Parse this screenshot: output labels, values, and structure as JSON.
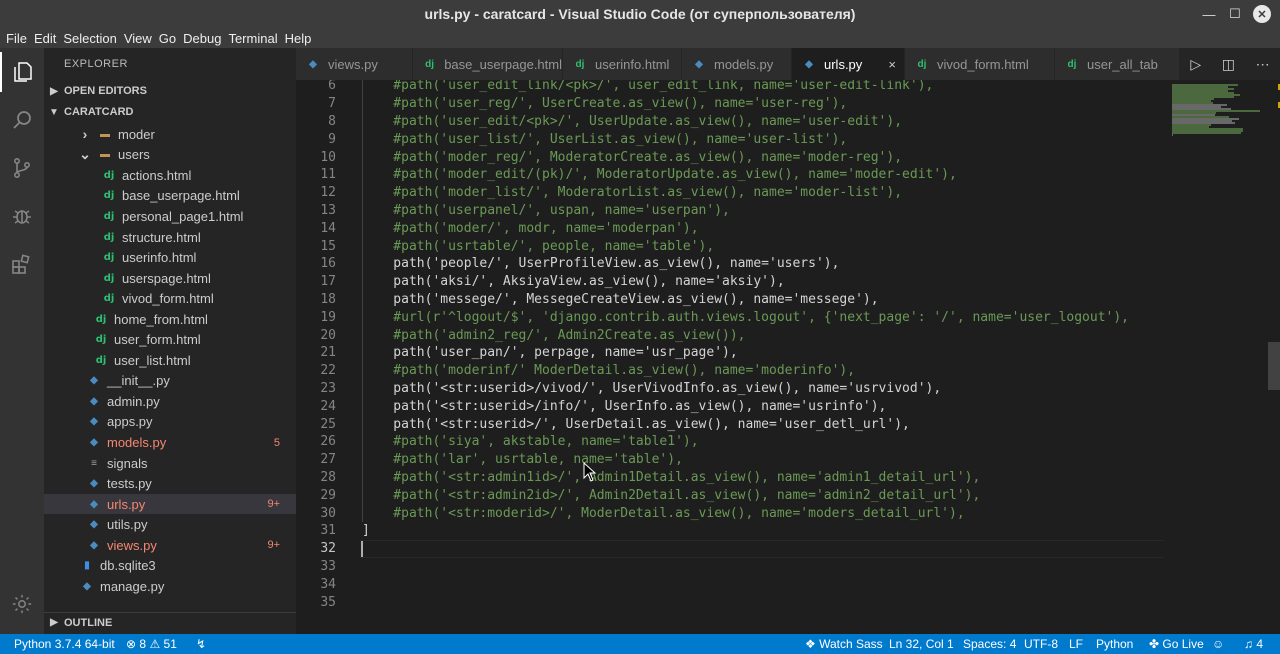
{
  "window": {
    "title": "urls.py - caratcard - Visual Studio Code (от суперпользователя)",
    "min_glyph": "—",
    "max_glyph": "☐",
    "close_glyph": "✕"
  },
  "menu": {
    "items": [
      "File",
      "Edit",
      "Selection",
      "View",
      "Go",
      "Debug",
      "Terminal",
      "Help"
    ]
  },
  "sidebar": {
    "title": "EXPLORER",
    "open_editors_label": "OPEN EDITORS",
    "project_label": "CARATCARD",
    "outline_label": "OUTLINE",
    "tree": [
      {
        "label": "moder",
        "type": "folder",
        "indent": 1,
        "expanded": false
      },
      {
        "label": "users",
        "type": "folder",
        "indent": 1,
        "expanded": true
      },
      {
        "label": "actions.html",
        "type": "dj",
        "indent": 2
      },
      {
        "label": "base_userpage.html",
        "type": "dj",
        "indent": 2
      },
      {
        "label": "personal_page1.html",
        "type": "dj",
        "indent": 2
      },
      {
        "label": "structure.html",
        "type": "dj",
        "indent": 2
      },
      {
        "label": "userinfo.html",
        "type": "dj",
        "indent": 2
      },
      {
        "label": "userspage.html",
        "type": "dj",
        "indent": 2
      },
      {
        "label": "vivod_form.html",
        "type": "dj",
        "indent": 2
      },
      {
        "label": "home_from.html",
        "type": "dj",
        "indent": 1
      },
      {
        "label": "user_form.html",
        "type": "dj",
        "indent": 1
      },
      {
        "label": "user_list.html",
        "type": "dj",
        "indent": 1
      },
      {
        "label": "__init__.py",
        "type": "py",
        "indent": 0
      },
      {
        "label": "admin.py",
        "type": "py",
        "indent": 0
      },
      {
        "label": "apps.py",
        "type": "py",
        "indent": 0
      },
      {
        "label": "models.py",
        "type": "py",
        "indent": 0,
        "badge": "5",
        "error": true
      },
      {
        "label": "signals",
        "type": "file",
        "indent": 0
      },
      {
        "label": "tests.py",
        "type": "py",
        "indent": 0
      },
      {
        "label": "urls.py",
        "type": "py",
        "indent": 0,
        "badge": "9+",
        "error": true,
        "selected": true
      },
      {
        "label": "utils.py",
        "type": "py",
        "indent": 0
      },
      {
        "label": "views.py",
        "type": "py",
        "indent": 0,
        "badge": "9+",
        "error": true
      },
      {
        "label": "db.sqlite3",
        "type": "db",
        "indent": -1
      },
      {
        "label": "manage.py",
        "type": "py",
        "indent": -1
      }
    ]
  },
  "tabs": [
    {
      "label": "views.py",
      "type": "py"
    },
    {
      "label": "base_userpage.html",
      "type": "dj"
    },
    {
      "label": "userinfo.html",
      "type": "dj"
    },
    {
      "label": "models.py",
      "type": "py"
    },
    {
      "label": "urls.py",
      "type": "py",
      "active": true
    },
    {
      "label": "vivod_form.html",
      "type": "dj"
    },
    {
      "label": "user_all_tab",
      "type": "dj"
    }
  ],
  "editor": {
    "current_line": 32,
    "lines": [
      {
        "n": "6",
        "t": "    #path('user_edit_link/<pk>/', user_edit_link, name='user-edit-link'),",
        "c": true
      },
      {
        "n": "7",
        "t": "    #path('user_reg/', UserCreate.as_view(), name='user-reg'),",
        "c": true
      },
      {
        "n": "8",
        "t": "    #path('user_edit/<pk>/', UserUpdate.as_view(), name='user-edit'),",
        "c": true
      },
      {
        "n": "9",
        "t": "    #path('user_list/', UserList.as_view(), name='user-list'),",
        "c": true
      },
      {
        "n": "10",
        "t": "    #path('moder_reg/', ModeratorCreate.as_view(), name='moder-reg'),",
        "c": true
      },
      {
        "n": "11",
        "t": "    #path('moder_edit/(pk)/', ModeratorUpdate.as_view(), name='moder-edit'),",
        "c": true
      },
      {
        "n": "12",
        "t": "    #path('moder_list/', ModeratorList.as_view(), name='moder-list'),",
        "c": true
      },
      {
        "n": "13",
        "t": "    #path('userpanel/', uspan, name='userpan'),",
        "c": true
      },
      {
        "n": "14",
        "t": "    #path('moder/', modr, name='moderpan'),",
        "c": true
      },
      {
        "n": "15",
        "t": "    #path('usrtable/', people, name='table'),",
        "c": true
      },
      {
        "n": "16",
        "t": "    path('people/', UserProfileView.as_view(), name='users'),",
        "c": false
      },
      {
        "n": "17",
        "t": "    path('aksi/', AksiyaView.as_view(), name='aksiy'),",
        "c": false
      },
      {
        "n": "18",
        "t": "    path('messege/', MessegeCreateView.as_view(), name='messege'),",
        "c": false
      },
      {
        "n": "19",
        "t": "    #url(r'^logout/$', 'django.contrib.auth.views.logout', {'next_page': '/', name='user_logout'),",
        "c": true
      },
      {
        "n": "20",
        "t": "    #path('admin2_reg/', Admin2Create.as_view()),",
        "c": true
      },
      {
        "n": "21",
        "t": "    path('user_pan/', perpage, name='usr_page'),",
        "c": false
      },
      {
        "n": "22",
        "t": "    #path('moderinf/' ModerDetail.as_view(), name='moderinfo'),",
        "c": true
      },
      {
        "n": "23",
        "t": "    path('<str:userid>/vivod/', UserVivodInfo.as_view(), name='usrvivod'),",
        "c": false
      },
      {
        "n": "24",
        "t": "    path('<str:userid>/info/', UserInfo.as_view(), name='usrinfo'),",
        "c": false
      },
      {
        "n": "25",
        "t": "    path('<str:userid>/', UserDetail.as_view(), name='user_detl_url'),",
        "c": false
      },
      {
        "n": "26",
        "t": "    #path('siya', akstable, name='table1'),",
        "c": true
      },
      {
        "n": "27",
        "t": "    #path('lar', usrtable, name='table'),",
        "c": true
      },
      {
        "n": "28",
        "t": "    #path('<str:admin1id>/', Admin1Detail.as_view(), name='admin1_detail_url'),",
        "c": true
      },
      {
        "n": "29",
        "t": "    #path('<str:admin2id>/', Admin2Detail.as_view(), name='admin2_detail_url'),",
        "c": true
      },
      {
        "n": "30",
        "t": "    #path('<str:moderid>/', ModerDetail.as_view(), name='moders_detail_url'),",
        "c": true
      },
      {
        "n": "31",
        "t": "]",
        "c": false
      },
      {
        "n": "32",
        "t": "",
        "c": false
      },
      {
        "n": "33",
        "t": "",
        "c": false
      },
      {
        "n": "34",
        "t": "",
        "c": false
      },
      {
        "n": "35",
        "t": "",
        "c": false
      }
    ]
  },
  "status": {
    "python": "Python 3.7.4 64-bit",
    "errors": "8",
    "warnings": "51",
    "watch_sass": "Watch Sass",
    "position": "Ln 32, Col 1",
    "spaces": "Spaces: 4",
    "encoding": "UTF-8",
    "eol": "LF",
    "language": "Python",
    "go_live": "Go Live",
    "notifications": "4"
  },
  "colors": {
    "accent": "#007acc",
    "comment": "#6a9955",
    "error_text": "#f48771",
    "django_icon": "#2fbf71",
    "python_icon": "#4b8bbe"
  }
}
